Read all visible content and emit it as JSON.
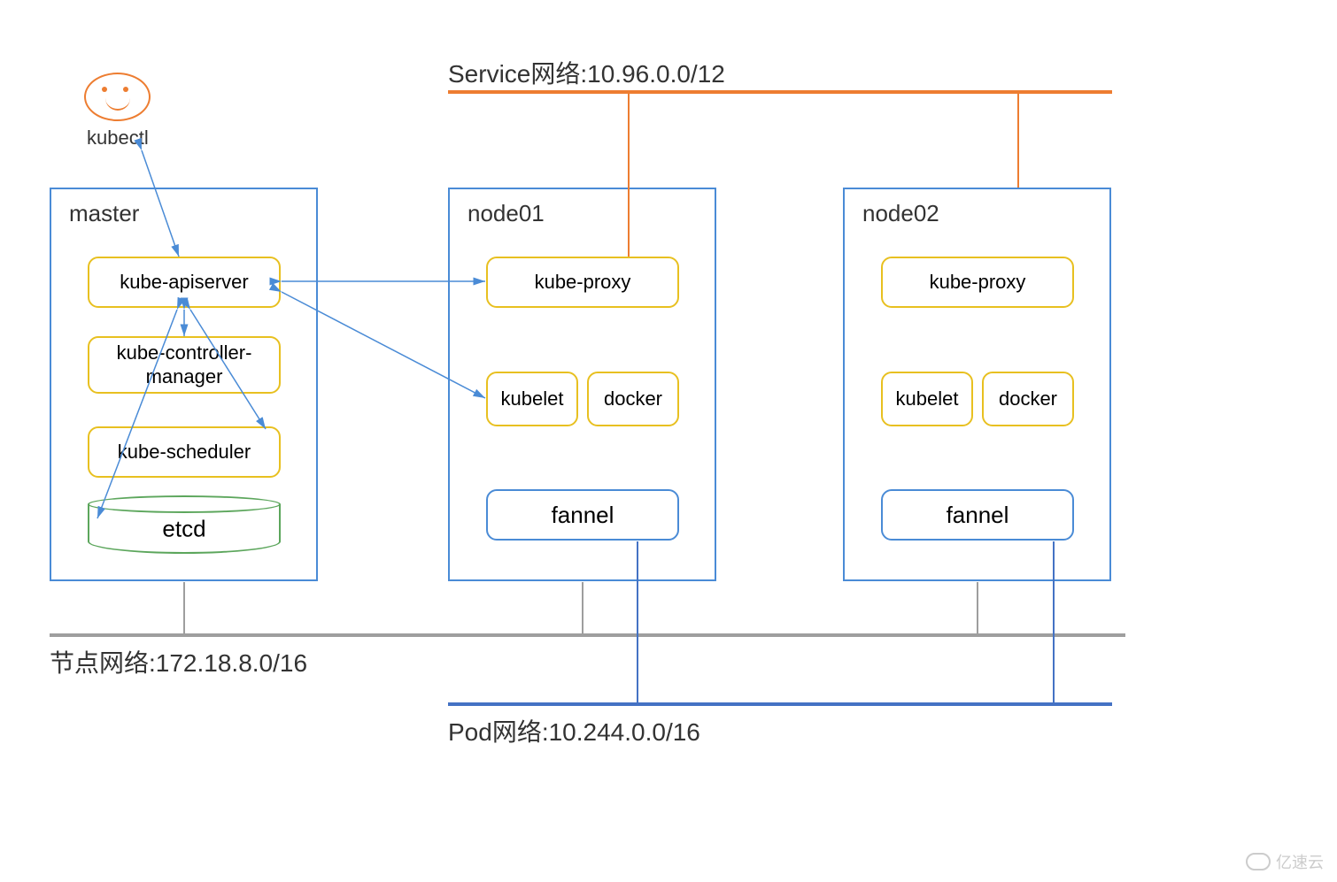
{
  "networks": {
    "service": "Service网络:10.96.0.0/12",
    "node": "节点网络:172.18.8.0/16",
    "pod": "Pod网络:10.244.0.0/16"
  },
  "kubectl": "kubectl",
  "master": {
    "title": "master",
    "apiserver": "kube-apiserver",
    "controller": "kube-controller-manager",
    "scheduler": "kube-scheduler",
    "etcd": "etcd"
  },
  "node01": {
    "title": "node01",
    "proxy": "kube-proxy",
    "kubelet": "kubelet",
    "docker": "docker",
    "flannel": "fannel"
  },
  "node02": {
    "title": "node02",
    "proxy": "kube-proxy",
    "kubelet": "kubelet",
    "docker": "docker",
    "flannel": "fannel"
  },
  "watermark": "亿速云"
}
